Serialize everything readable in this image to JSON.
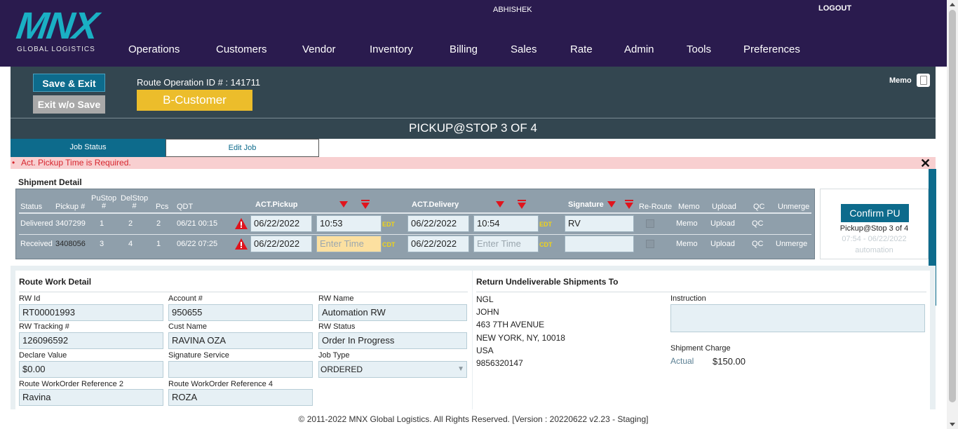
{
  "header": {
    "logo_text": "MNX",
    "logo_sub": "GLOBAL LOGISTICS",
    "username": "ABHISHEK",
    "logout": "LOGOUT",
    "nav": [
      "Operations",
      "Customers",
      "Vendor",
      "Inventory",
      "Billing",
      "Sales",
      "Rate",
      "Admin",
      "Tools",
      "Preferences"
    ]
  },
  "actions": {
    "save_exit": "Save & Exit",
    "exit_without_save": "Exit w/o Save",
    "route_id_label": "Route Operation ID # : 141711",
    "customer_badge": "B-Customer",
    "memo": "Memo"
  },
  "stop_title": "PICKUP@STOP 3 OF 4",
  "tabs": {
    "job_status": "Job Status",
    "edit_job": "Edit Job"
  },
  "error_message": "Act. Pickup Time is Required.",
  "close_symbol": "✕",
  "shipment": {
    "title": "Shipment Detail",
    "headers": {
      "status": "Status",
      "pickup": "Pickup #",
      "pustop_1": "PuStop",
      "pustop_2": "#",
      "delstop_1": "DelStop",
      "delstop_2": "#",
      "pcs": "Pcs",
      "qdt": "QDT",
      "act_pickup": "ACT.Pickup",
      "act_delivery": "ACT.Delivery",
      "signature": "Signature",
      "reroute": "Re-Route",
      "memo": "Memo",
      "upload": "Upload",
      "qc": "QC",
      "unmerge": "Unmerge"
    },
    "rows": [
      {
        "status": "Delivered",
        "pickup": "3407299",
        "pustop": "1",
        "delstop": "2",
        "pcs": "2",
        "qdt": "06/21 00:15",
        "pickup_date": "06/22/2022",
        "pickup_time": "10:53",
        "pickup_tz": "EDT",
        "delivery_date": "06/22/2022",
        "delivery_time": "10:54",
        "delivery_tz": "EDT",
        "signature": "RV",
        "memo": "Memo",
        "upload": "Upload",
        "qc": "QC",
        "unmerge": ""
      },
      {
        "status": "Received",
        "pickup": "3408056",
        "pustop": "3",
        "delstop": "4",
        "pcs": "1",
        "qdt": "06/22 07:25",
        "pickup_date": "06/22/2022",
        "pickup_time_placeholder": "Enter Time",
        "pickup_tz": "CDT",
        "delivery_date": "06/22/2022",
        "delivery_time_placeholder": "Enter Time",
        "delivery_tz": "CDT",
        "signature": "",
        "memo": "Memo",
        "upload": "Upload",
        "qc": "QC",
        "unmerge": "Unmerge"
      }
    ]
  },
  "confirm": {
    "button": "Confirm PU",
    "stop": "Pickup@Stop 3 of 4",
    "time_window": "07:54 - 06/22/2022",
    "user": "automation"
  },
  "route_work": {
    "title": "Route Work Detail",
    "fields": {
      "rw_id_label": "RW Id",
      "rw_id": "RT00001993",
      "account_label": "Account #",
      "account": "950655",
      "rw_name_label": "RW Name",
      "rw_name": "Automation RW",
      "tracking_label": "RW Tracking #",
      "tracking": "126096592",
      "cust_name_label": "Cust Name",
      "cust_name": "RAVINA OZA",
      "rw_status_label": "RW Status",
      "rw_status": "Order In Progress",
      "declare_label": "Declare Value",
      "declare": "$0.00",
      "signature_label": "Signature Service",
      "signature_service": "",
      "job_type_label": "Job Type",
      "job_type": "ORDERED",
      "ref2_label": "Route WorkOrder Reference 2",
      "ref2": "Ravina",
      "ref4_label": "Route WorkOrder Reference 4",
      "ref4": "ROZA"
    }
  },
  "return_to": {
    "title": "Return Undeliverable Shipments To",
    "address": [
      "NGL",
      "JOHN",
      "463 7TH AVENUE",
      "NEW YORK, NY, 10018",
      "USA",
      "9856320147"
    ],
    "instruction_label": "Instruction",
    "instruction": "",
    "charge_label": "Shipment Charge",
    "actual_label": "Actual",
    "charge_value": "$150.00"
  },
  "footer": "© 2011-2022 MNX Global Logistics. All Rights Reserved. [Version : 20220622 v2.23 - Staging]",
  "colors": {
    "header_bg": "#2a1b4e",
    "brand_teal": "#1ab0c4",
    "primary_blue": "#0d6b8c",
    "badge_yellow": "#ecbd2b",
    "error_red": "#d6262e"
  }
}
